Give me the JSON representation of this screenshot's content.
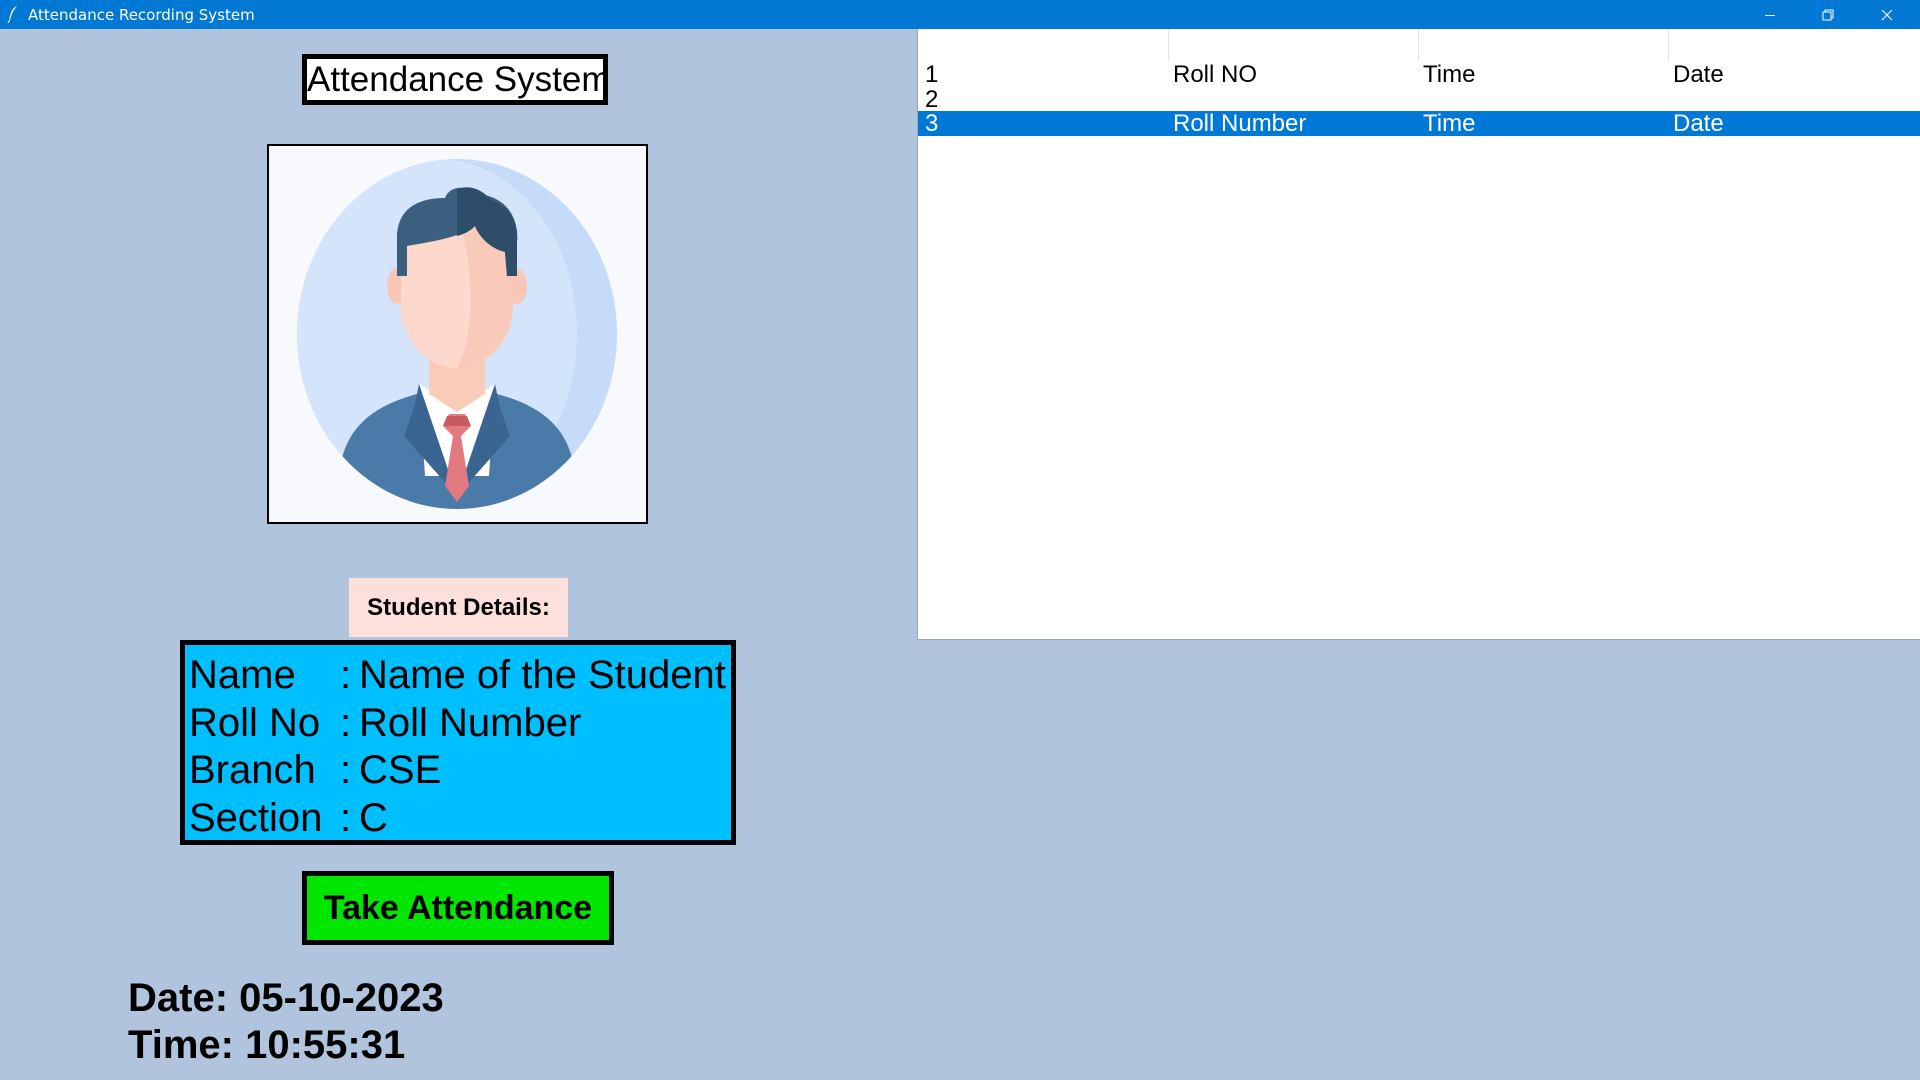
{
  "window": {
    "title": "Attendance Recording System"
  },
  "app": {
    "heading": "Attendance System",
    "photo_alt": "student-avatar"
  },
  "details": {
    "label": "Student Details:",
    "rows": [
      {
        "key": "Name",
        "sep": ":",
        "value": "Name of the Student"
      },
      {
        "key": "Roll No",
        "sep": ":",
        "value": "Roll Number"
      },
      {
        "key": "Branch",
        "sep": ":",
        "value": "CSE"
      },
      {
        "key": "Section",
        "sep": ":",
        "value": "C"
      }
    ]
  },
  "actions": {
    "take_attendance": "Take Attendance"
  },
  "clock": {
    "date_label": "Date: 05-10-2023",
    "time_label": "Time: 10:55:31"
  },
  "table": {
    "rows": [
      {
        "id": "1",
        "roll": "Roll NO",
        "time": "Time",
        "date": "Date",
        "selected": false
      },
      {
        "id": "2",
        "roll": "",
        "time": "",
        "date": "",
        "selected": false
      },
      {
        "id": "3",
        "roll": "Roll Number",
        "time": "Time",
        "date": "Date",
        "selected": true
      }
    ]
  },
  "colors": {
    "background": "#b0c4de",
    "titlebar": "#0078d4",
    "details_box": "#00bfff",
    "details_label": "#fde0dc",
    "button": "#00e600",
    "selection": "#0078d7"
  },
  "icons": {
    "app": "feather-icon",
    "minimize": "minimize-icon",
    "maximize": "restore-icon",
    "close": "close-icon"
  }
}
